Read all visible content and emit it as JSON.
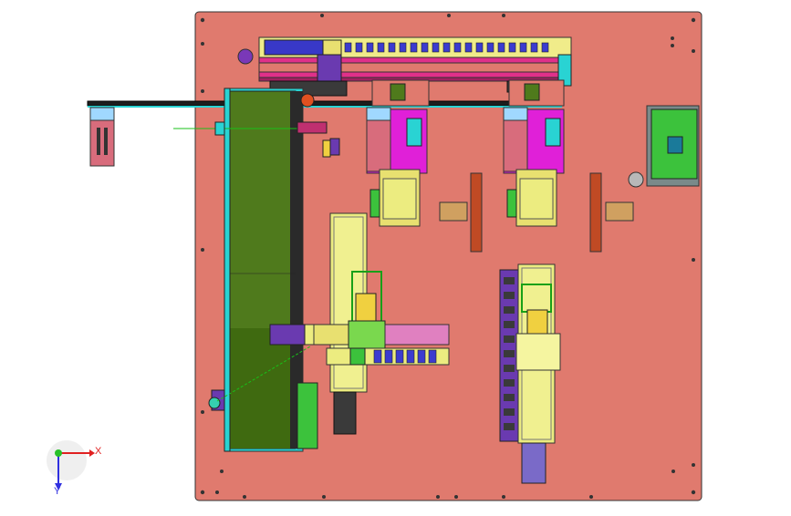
{
  "viewport": {
    "triad": {
      "x_label": "X",
      "y_label": "Y"
    }
  },
  "colors": {
    "plate": "#e07a6e",
    "belt": "#4f7a1c",
    "rail_cyan": "#29d3d3",
    "magenta": "#e020d8",
    "yellow": "#ecec70",
    "green": "#7ad84e",
    "purple": "#6a3ab0",
    "blue": "#3838c8",
    "dark": "#222222"
  }
}
